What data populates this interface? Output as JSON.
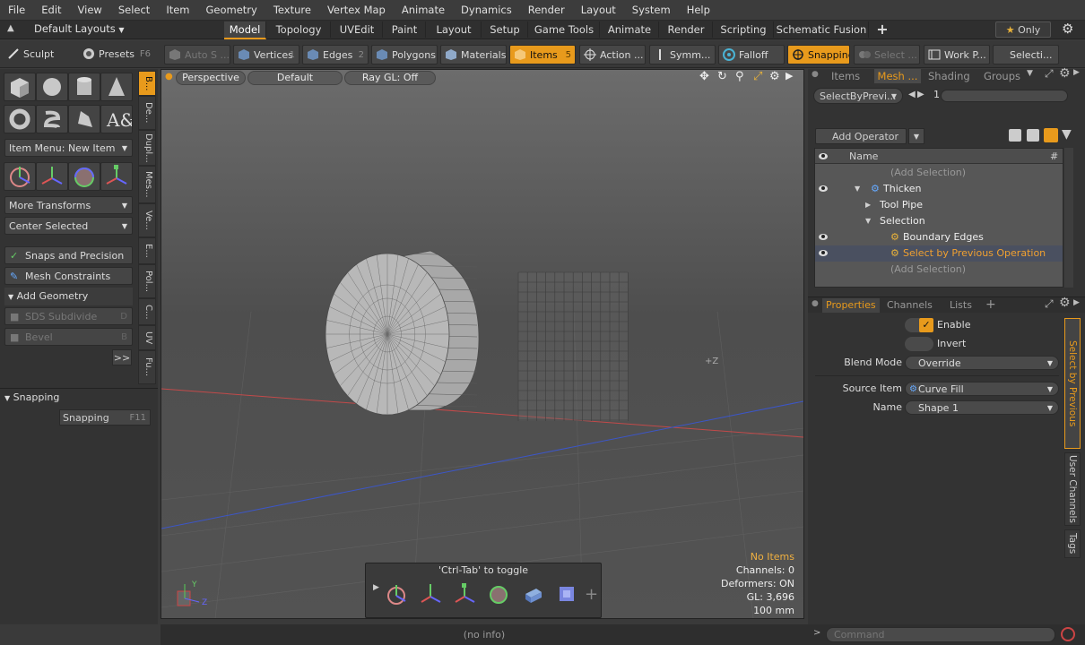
{
  "menu": [
    "File",
    "Edit",
    "View",
    "Select",
    "Item",
    "Geometry",
    "Texture",
    "Vertex Map",
    "Animate",
    "Dynamics",
    "Render",
    "Layout",
    "System",
    "Help"
  ],
  "layoutbar": {
    "layout_selector": "Default Layouts",
    "tabs": [
      "Model",
      "Topology",
      "UVEdit",
      "Paint",
      "Layout",
      "Setup",
      "Game Tools",
      "Animate",
      "Render",
      "Scripting",
      "Schematic Fusion"
    ],
    "active_tab": "Model",
    "add": "+",
    "only_label": "Only"
  },
  "toolbar": {
    "sculpt": "Sculpt",
    "presets": "Presets",
    "presets_shortcut": "F6",
    "auto_select": "Auto S ...",
    "vertices": "Vertices",
    "vertices_key": "1",
    "edges": "Edges",
    "edges_key": "2",
    "polygons": "Polygons",
    "materials": "Materials",
    "items": "Items",
    "items_key": "5",
    "action": "Action ...",
    "symmetry": "Symm...",
    "falloff": "Falloff",
    "snapping": "Snapping",
    "select_through": "Select ...",
    "workplane": "Work P...",
    "selection_sets": "Selecti..."
  },
  "leftpanel": {
    "item_menu": "Item Menu: New Item",
    "more_transforms": "More Transforms",
    "center_selected": "Center Selected",
    "snaps_precision": "Snaps and Precision",
    "mesh_constraints": "Mesh Constraints",
    "add_geometry": "Add Geometry",
    "sds_subdivide": "SDS Subdivide",
    "sds_key": "D",
    "bevel": "Bevel",
    "bevel_key": "B",
    "more": ">>",
    "snapping_header": "Snapping",
    "snapping_btn": "Snapping",
    "snapping_key": "F11",
    "vtabs": [
      "B...",
      "De...",
      "Dupl...",
      "Mes...",
      "Ve...",
      "E...",
      "Pol...",
      "C...",
      "UV",
      "Fu..."
    ]
  },
  "viewport": {
    "view": "Perspective",
    "shading": "Default",
    "raygl": "Ray GL: Off",
    "toggle_hint": "'Ctrl-Tab' to toggle",
    "info": {
      "items": "No Items",
      "channels": "Channels: 0",
      "deformers": "Deformers: ON",
      "gl": "GL: 3,696",
      "scale": "100 mm"
    },
    "axis_label": "+Z",
    "gizmo_y": "Y",
    "gizmo_z": "Z"
  },
  "rightpanel": {
    "top_tabs": [
      "Items",
      "Mesh ...",
      "Shading",
      "Groups"
    ],
    "active_top_tab": "Mesh ...",
    "selector": "SelectByPrevi...",
    "slider_value": "1",
    "add_operator": "Add Operator",
    "col_name": "Name",
    "col_hash": "#",
    "tree": [
      {
        "label": "(Add Selection)",
        "dim": true,
        "eye": false
      },
      {
        "label": "Thicken",
        "dim": false,
        "eye": true
      },
      {
        "label": "Tool Pipe",
        "dim": false,
        "eye": false
      },
      {
        "label": "Selection",
        "dim": false,
        "eye": false
      },
      {
        "label": "Boundary Edges",
        "dim": false,
        "eye": true
      },
      {
        "label": "Select by Previous Operation",
        "dim": false,
        "eye": true,
        "selected": true
      },
      {
        "label": "(Add Selection)",
        "dim": true,
        "eye": false
      }
    ],
    "prop_tabs": [
      "Properties",
      "Channels",
      "Lists"
    ],
    "active_prop_tab": "Properties",
    "props": {
      "enable": "Enable",
      "invert": "Invert",
      "blend_mode_label": "Blend Mode",
      "blend_mode_value": "Override",
      "source_item_label": "Source Item",
      "source_item_value": "Curve Fill",
      "name_label": "Name",
      "name_value": "Shape 1"
    },
    "side_tabs": [
      "Select by Previous Operation",
      "User Channels",
      "Tags"
    ]
  },
  "status": "(no info)",
  "command_placeholder": "Command",
  "colors": {
    "accent": "#e89a1c",
    "selected_row": "#4a5060"
  }
}
